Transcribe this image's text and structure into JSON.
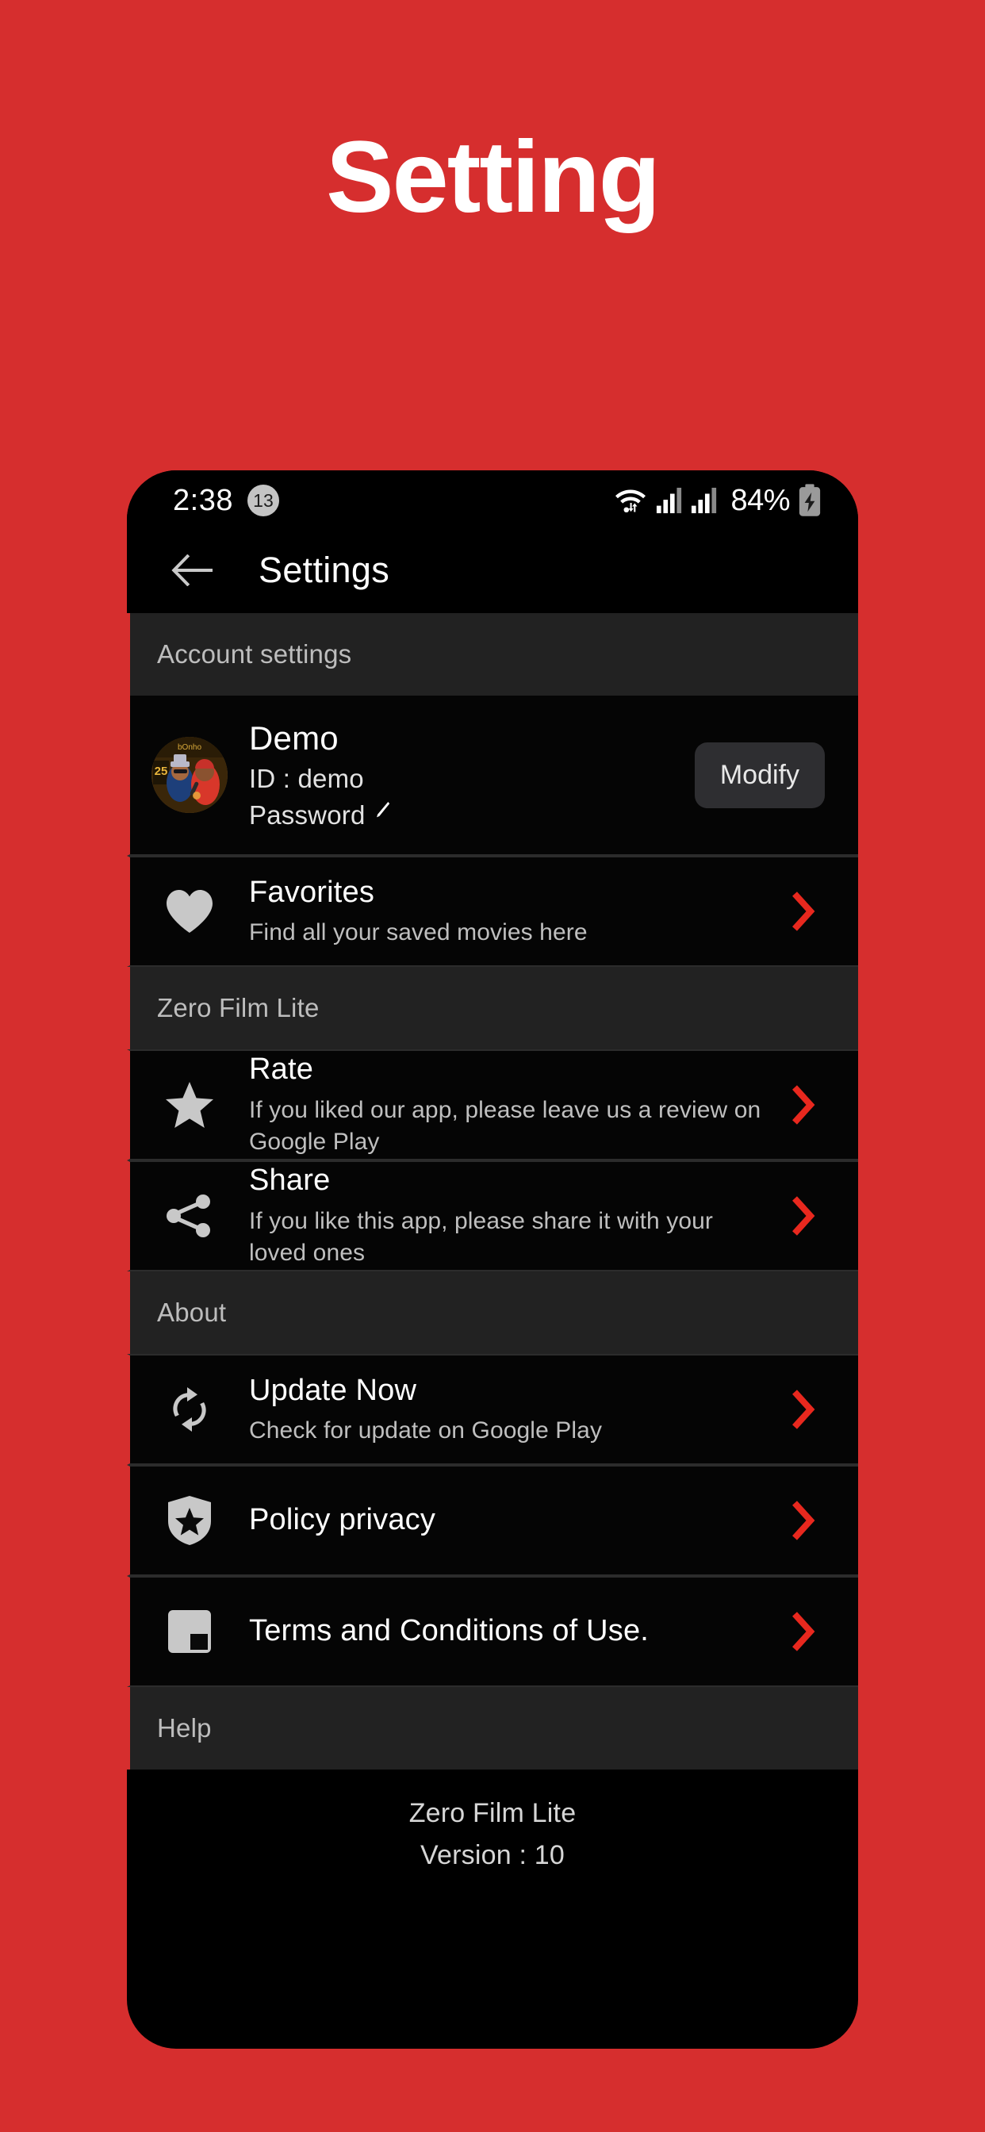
{
  "hero": {
    "title": "Setting"
  },
  "colors": {
    "background_red": "#D62E2E",
    "accent_red": "#E8281E",
    "panel_black": "#050505",
    "section_grey": "#222222"
  },
  "phone": {
    "status_bar": {
      "clock": "2:38",
      "badge_count": "13",
      "wifi_icon": "wifi-updown-icon",
      "signal_icon_1": "signal-bars-icon",
      "signal_icon_2": "signal-bars-icon",
      "battery_percent": "84%",
      "battery_icon": "battery-charging-icon"
    },
    "app_bar": {
      "back_icon": "arrow-left-icon",
      "title": "Settings"
    },
    "sections": [
      {
        "header": "Account settings",
        "account": {
          "avatar": "user-avatar",
          "name": "Demo",
          "id": "ID : demo",
          "password": "Password",
          "password_edit_icon": "pencil-icon",
          "modify_label": "Modify"
        }
      },
      {
        "header": "Zero Film Lite"
      },
      {
        "header": "About"
      },
      {
        "header": "Help"
      }
    ],
    "rows": {
      "favorites": {
        "icon": "heart-icon",
        "title": "Favorites",
        "subtitle": "Find all your saved movies here",
        "chevron": "chevron-right-icon"
      },
      "rate": {
        "icon": "star-icon",
        "title": "Rate",
        "subtitle": "If you liked our app, please leave us a review on Google Play",
        "chevron": "chevron-right-icon"
      },
      "share": {
        "icon": "share-icon",
        "title": "Share",
        "subtitle": "If you like this app, please share it with your loved ones",
        "chevron": "chevron-right-icon"
      },
      "update": {
        "icon": "refresh-icon",
        "title": "Update Now",
        "subtitle": "Check for update on Google Play",
        "chevron": "chevron-right-icon"
      },
      "policy": {
        "icon": "shield-star-icon",
        "title": "Policy privacy",
        "chevron": "chevron-right-icon"
      },
      "terms": {
        "icon": "document-icon",
        "title": "Terms and Conditions of Use.",
        "chevron": "chevron-right-icon"
      }
    },
    "footer": {
      "app_name": "Zero Film Lite",
      "version": "Version : 10"
    }
  }
}
